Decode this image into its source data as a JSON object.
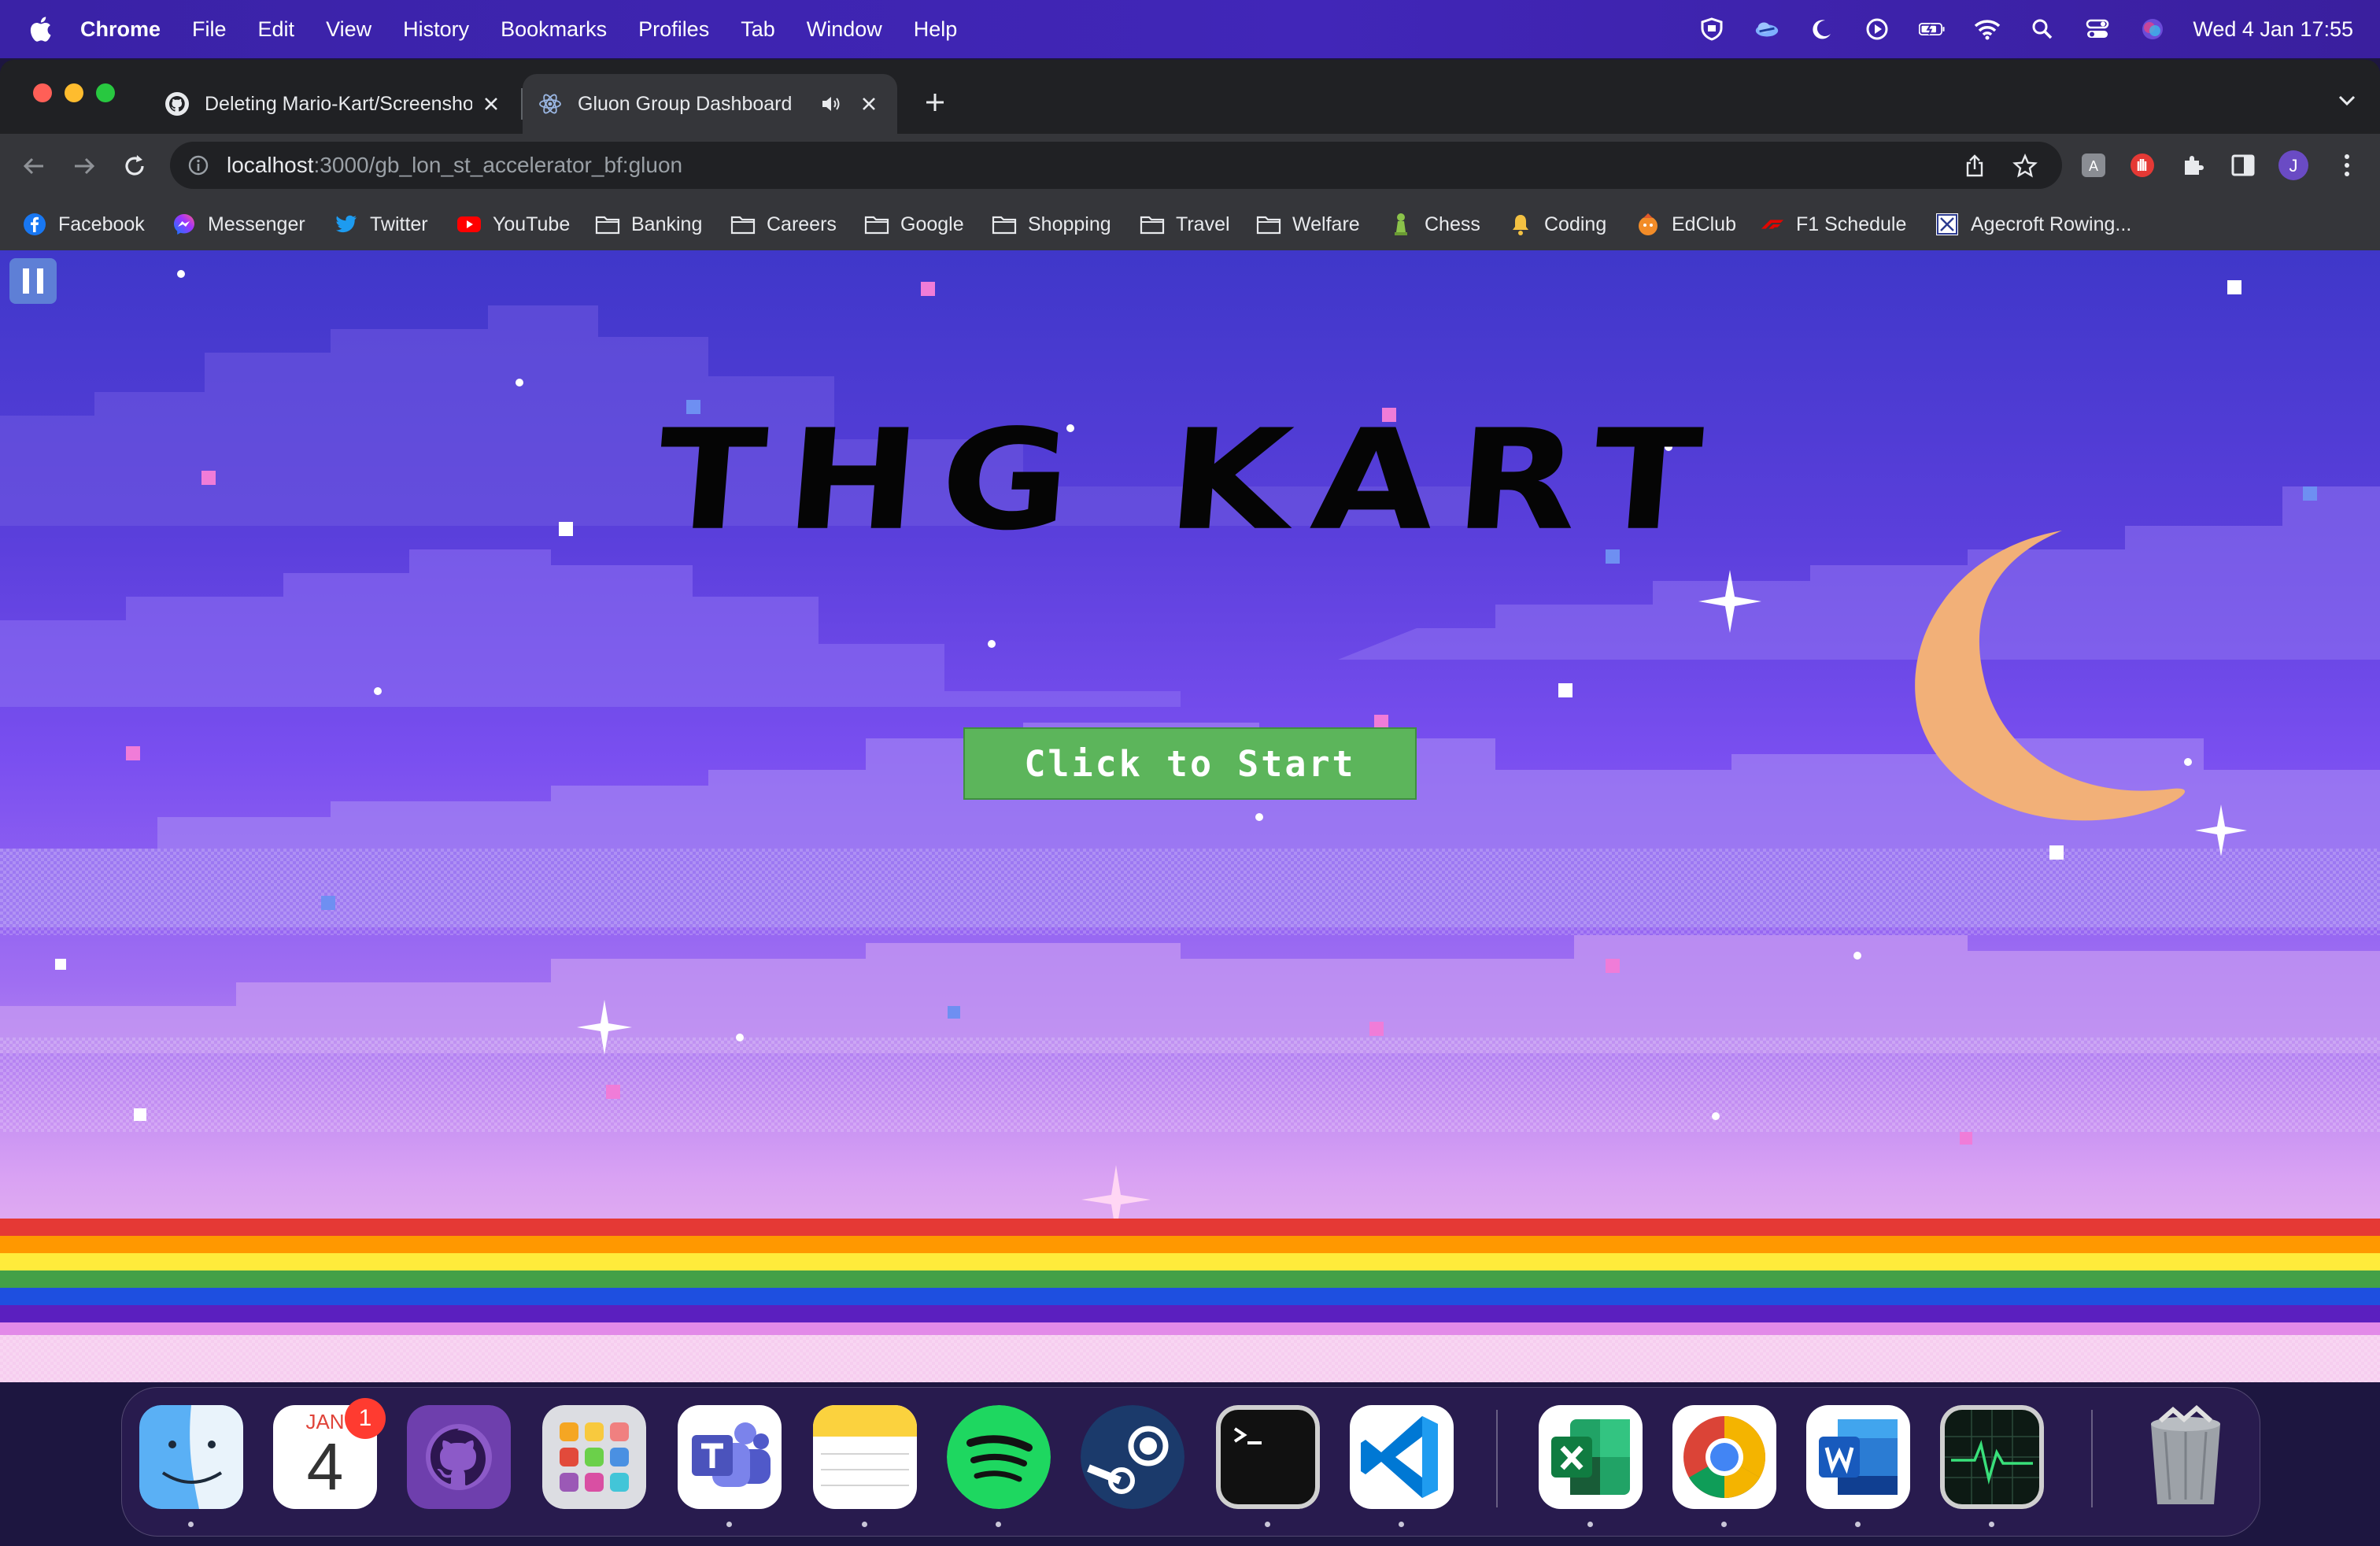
{
  "menubar": {
    "app_name": "Chrome",
    "items": [
      "File",
      "Edit",
      "View",
      "History",
      "Bookmarks",
      "Profiles",
      "Tab",
      "Window",
      "Help"
    ],
    "clock": "Wed 4 Jan  17:55"
  },
  "browser": {
    "tabs": [
      {
        "title": "Deleting Mario-Kart/Screensho",
        "icon": "github-icon"
      },
      {
        "title": "Gluon Group Dashboard",
        "icon": "react-icon",
        "active": true,
        "audio": true
      }
    ],
    "url": {
      "host": "localhost",
      "path": ":3000/gb_lon_st_accelerator_bf:gluon"
    },
    "profile_initial": "J",
    "bookmarks": [
      {
        "label": "Facebook",
        "icon": "facebook-icon"
      },
      {
        "label": "Messenger",
        "icon": "messenger-icon"
      },
      {
        "label": "Twitter",
        "icon": "twitter-icon"
      },
      {
        "label": "YouTube",
        "icon": "youtube-icon"
      },
      {
        "label": "Banking",
        "icon": "folder-icon"
      },
      {
        "label": "Careers",
        "icon": "folder-icon"
      },
      {
        "label": "Google",
        "icon": "folder-icon"
      },
      {
        "label": "Shopping",
        "icon": "folder-icon"
      },
      {
        "label": "Travel",
        "icon": "folder-icon"
      },
      {
        "label": "Welfare",
        "icon": "folder-icon"
      },
      {
        "label": "Chess",
        "icon": "chess-icon"
      },
      {
        "label": "Coding",
        "icon": "bell-icon"
      },
      {
        "label": "EdClub",
        "icon": "edclub-icon"
      },
      {
        "label": "F1 Schedule",
        "icon": "f1-icon"
      },
      {
        "label": "Agecroft Rowing...",
        "icon": "rowing-icon"
      }
    ]
  },
  "game": {
    "title": "THG KART",
    "start_label": "Click to Start",
    "colors": {
      "sky_top": "#3f37c9",
      "sky_mid": "#7a4ff0",
      "sky_low": "#c58ef0",
      "start_button": "#5cb55b",
      "moon": "#f2b078"
    },
    "rainbow": [
      "#e53935",
      "#ff9800",
      "#ffeb3b",
      "#43a047",
      "#1e4fe0",
      "#5b1fbf"
    ]
  },
  "dock": {
    "apps": [
      "Finder",
      "Calendar",
      "GitHub Desktop",
      "Launchpad",
      "Microsoft Teams",
      "Notes",
      "Spotify",
      "Steam",
      "Terminal",
      "Visual Studio Code",
      "Microsoft Excel",
      "Google Chrome",
      "Microsoft Word",
      "Activity Monitor",
      "Trash"
    ],
    "calendar_month": "JAN",
    "calendar_day": "4",
    "calendar_badge": "1"
  }
}
